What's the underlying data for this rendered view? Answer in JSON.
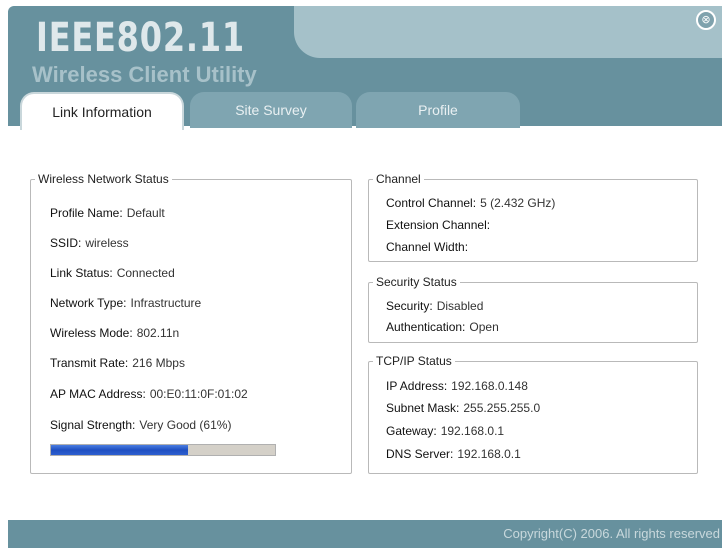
{
  "header": {
    "brand": "IEEE802.11",
    "subtitle": "Wireless Client Utility",
    "close_glyph": "⊗"
  },
  "tabs": [
    {
      "label": "Link Information",
      "active": true
    },
    {
      "label": "Site Survey",
      "active": false
    },
    {
      "label": "Profile",
      "active": false
    }
  ],
  "wireless_status": {
    "legend": "Wireless Network Status",
    "rows": [
      {
        "label": "Profile Name:",
        "value": "Default"
      },
      {
        "label": "SSID:",
        "value": "wireless"
      },
      {
        "label": "Link Status:",
        "value": "Connected"
      },
      {
        "label": "Network Type:",
        "value": "Infrastructure"
      },
      {
        "label": "Wireless Mode:",
        "value": "802.11n"
      },
      {
        "label": "Transmit Rate:",
        "value": "216 Mbps"
      },
      {
        "label": "AP MAC Address:",
        "value": "00:E0:11:0F:01:02"
      },
      {
        "label": "Signal Strength:",
        "value": "Very Good (61%)"
      }
    ],
    "signal_percent": 61
  },
  "channel": {
    "legend": "Channel",
    "rows": [
      {
        "label": "Control Channel:",
        "value": "5 (2.432 GHz)"
      },
      {
        "label": "Extension Channel:",
        "value": ""
      },
      {
        "label": "Channel Width:",
        "value": ""
      }
    ]
  },
  "security": {
    "legend": "Security Status",
    "rows": [
      {
        "label": "Security:",
        "value": "Disabled"
      },
      {
        "label": "Authentication:",
        "value": "Open"
      }
    ]
  },
  "tcpip": {
    "legend": "TCP/IP Status",
    "rows": [
      {
        "label": "IP Address:",
        "value": "192.168.0.148"
      },
      {
        "label": "Subnet Mask:",
        "value": "255.255.255.0"
      },
      {
        "label": "Gateway:",
        "value": "192.168.0.1"
      },
      {
        "label": "DNS Server:",
        "value": "192.168.0.1"
      }
    ]
  },
  "footer": {
    "copyright": "Copyright(C) 2006. All rights reserved"
  },
  "colors": {
    "header": "#67919e",
    "tab_inactive": "#7fa5b1",
    "progress_fill": "#1f4fc1"
  },
  "icons": {
    "close": "close-icon"
  }
}
